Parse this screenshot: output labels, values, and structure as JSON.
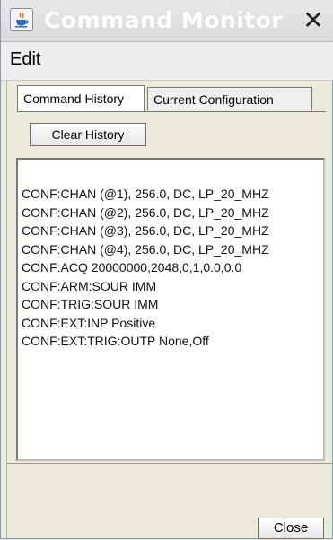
{
  "window": {
    "title": "Command Monitor",
    "close_glyph": "✕"
  },
  "menu": {
    "items": [
      "Edit"
    ]
  },
  "tabs": [
    {
      "label": "Command History",
      "active": true
    },
    {
      "label": "Current Configuration",
      "active": false
    }
  ],
  "toolbar": {
    "clear_label": "Clear History"
  },
  "history": {
    "lines": [
      "CONF:CHAN (@1), 256.0, DC, LP_20_MHZ",
      "CONF:CHAN (@2), 256.0, DC, LP_20_MHZ",
      "CONF:CHAN (@3), 256.0, DC, LP_20_MHZ",
      "CONF:CHAN (@4), 256.0, DC, LP_20_MHZ",
      "CONF:ACQ 20000000,2048,0,1,0.0,0.0",
      "CONF:ARM:SOUR IMM",
      "CONF:TRIG:SOUR IMM",
      "CONF:EXT:INP Positive",
      "CONF:EXT:TRIG:OUTP None,Off"
    ]
  },
  "footer": {
    "close_label": "Close"
  },
  "icons": {
    "app": "java-cup-icon",
    "close": "close-icon"
  }
}
